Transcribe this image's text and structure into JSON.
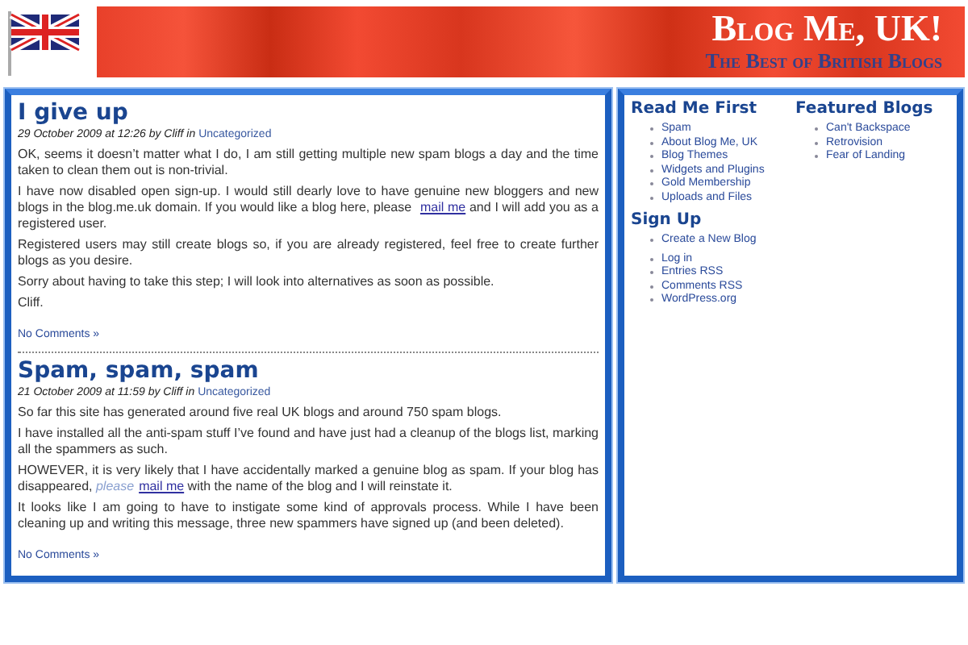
{
  "header": {
    "title": "Blog Me, UK!",
    "tagline": "The Best of British Blogs"
  },
  "posts": [
    {
      "title": "I give up",
      "meta": {
        "date": "29 October 2009 at 12:26 by Cliff in",
        "category": "Uncategorized"
      },
      "paragraphs": [
        [
          {
            "kind": "text",
            "text": "OK, seems it doesn’t matter what I do, I am still getting multiple new spam blogs a day and the time taken to clean them out is non-trivial."
          }
        ],
        [
          {
            "kind": "text",
            "text": "I have now disabled open sign-up. I would still dearly love to have genuine new bloggers and new blogs in the blog.me.uk domain. If you would like a blog here, please "
          },
          {
            "kind": "link",
            "text": "mail me"
          },
          {
            "kind": "text",
            "text": " and I will add you as a registered user."
          }
        ],
        [
          {
            "kind": "text",
            "text": "Registered users may still create blogs so, if you are already registered, feel free to create further blogs as you desire."
          }
        ],
        [
          {
            "kind": "text",
            "text": "Sorry about having to take this step; I will look into alternatives as soon as possible."
          }
        ],
        [
          {
            "kind": "text",
            "text": "Cliff."
          }
        ]
      ],
      "comments": "No Comments »"
    },
    {
      "title": "Spam, spam, spam",
      "meta": {
        "date": "21 October 2009 at 11:59 by Cliff in",
        "category": "Uncategorized"
      },
      "paragraphs": [
        [
          {
            "kind": "text",
            "text": "So far this site has generated around five real UK blogs and around 750 spam blogs."
          }
        ],
        [
          {
            "kind": "text",
            "text": "I have installed all the anti-spam stuff I’ve found and have just had a cleanup of the blogs list, marking all the spammers as such."
          }
        ],
        [
          {
            "kind": "text",
            "text": "HOWEVER, it is very likely that I have accidentally marked a genuine blog as spam. If your blog has disappeared, "
          },
          {
            "kind": "emphasis",
            "text": "please"
          },
          {
            "kind": "link",
            "text": "mail me"
          },
          {
            "kind": "text",
            "text": " with the name of the blog and I will reinstate it."
          }
        ],
        [
          {
            "kind": "text",
            "text": "It looks like I am going to have to instigate some kind of approvals process. While I have been cleaning up and writing this message, three new spammers have signed up (and been deleted)."
          }
        ]
      ],
      "comments": "No Comments »"
    }
  ],
  "sidebar": {
    "columns": [
      [
        {
          "heading": "Read Me First",
          "items": [
            "Spam",
            "About Blog Me, UK",
            "Blog Themes",
            "Widgets and Plugins",
            "Gold Membership",
            "Uploads and Files"
          ]
        },
        {
          "heading": "Sign Up",
          "items": [
            "Create a New Blog"
          ]
        },
        {
          "items": [
            "Log in",
            "Entries RSS",
            "Comments RSS",
            "WordPress.org"
          ]
        }
      ],
      [
        {
          "heading": "Featured Blogs",
          "items": [
            "Can't Backspace",
            "Retrovision",
            "Fear of Landing"
          ]
        }
      ]
    ]
  }
}
